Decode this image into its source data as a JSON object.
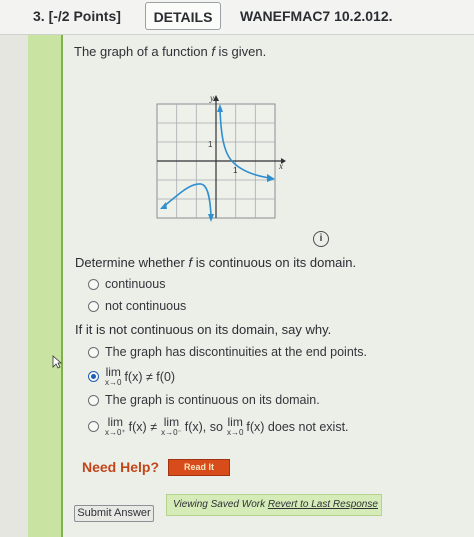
{
  "header": {
    "question_number": "3.  [-/2 Points]",
    "details_label": "DETAILS",
    "problem_code": "WANEFMAC7 10.2.012."
  },
  "intro": {
    "prefix": "The graph of a function ",
    "var": "f",
    "suffix": " is given."
  },
  "graph": {
    "y_label": "y",
    "x_label": "x",
    "y_tick": "1",
    "x_tick": "1"
  },
  "info_icon": "i",
  "question1": {
    "text_prefix": "Determine whether ",
    "var": "f",
    "text_suffix": " is continuous on its domain.",
    "options": [
      "continuous",
      "not continuous"
    ]
  },
  "question2": {
    "text": "If it is not continuous on its domain, say why.",
    "option1": "The graph has discontinuities at the end points.",
    "option2": {
      "lim": "lim",
      "sub": "x→0",
      "expr": "f(x) ≠ f(0)"
    },
    "option3": "The graph is continuous on its domain.",
    "option4": {
      "lim": "lim",
      "sub_a": "x→0⁺",
      "expr_a": "f(x) ≠",
      "sub_b": "x→0⁻",
      "expr_b": "f(x), so",
      "sub_c": "x→0",
      "expr_c": "f(x) does not exist."
    },
    "selected_index": 1
  },
  "help": {
    "label": "Need Help?",
    "read_it": "Read It"
  },
  "footer": {
    "submit": "Submit Answer",
    "viewing": "Viewing Saved Work",
    "revert": "Revert to Last Response"
  }
}
